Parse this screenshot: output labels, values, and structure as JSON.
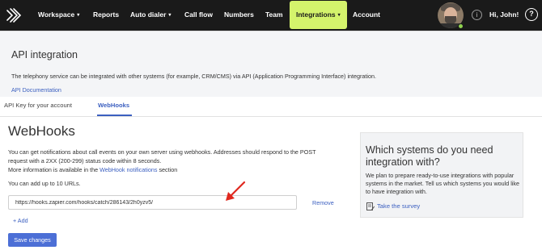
{
  "nav": {
    "items": [
      {
        "label": "Workspace",
        "dropdown": true
      },
      {
        "label": "Reports",
        "dropdown": false
      },
      {
        "label": "Auto dialer",
        "dropdown": true
      },
      {
        "label": "Call flow",
        "dropdown": false
      },
      {
        "label": "Numbers",
        "dropdown": false
      },
      {
        "label": "Team",
        "dropdown": false
      },
      {
        "label": "Integrations",
        "dropdown": true,
        "active": true
      },
      {
        "label": "Account",
        "dropdown": false
      }
    ],
    "greeting": "Hi, John!",
    "info_glyph": "i",
    "help_glyph": "?",
    "caret_glyph": "▾",
    "accent_color": "#d4f36c",
    "bar_color": "#1a1a1a"
  },
  "header": {
    "title": "API integration",
    "description": "The telephony service can be integrated with other systems (for example, CRM/CMS) via API (Application Programming Interface) integration.",
    "doc_link": "API Documentation"
  },
  "tabs": [
    {
      "label": "API Key for your account",
      "active": false
    },
    {
      "label": "WebHooks",
      "active": true
    }
  ],
  "webhooks": {
    "title": "WebHooks",
    "desc_line1": "You can get notifications about call events on your own server using webhooks. Addresses should respond to the POST",
    "desc_line2": "request with a 2XX (200-299) status code within 8 seconds.",
    "more_info_prefix": "More information is available in the ",
    "more_info_link": "WebHook notifications",
    "more_info_suffix": " section",
    "limit_text": "You can add up to 10 URLs.",
    "url_value": "https://hooks.zapier.com/hooks/catch/286143/2h0yzv5/",
    "remove_label": "Remove",
    "add_label": "+ Add",
    "save_label": "Save changes"
  },
  "side_panel": {
    "title": "Which systems do you need integration with?",
    "text": "We plan to prepare ready-to-use integrations with popular systems in the market. Tell us which systems you would like to have integration with.",
    "survey_link": "Take the survey"
  },
  "colors": {
    "link": "#3b5fc0",
    "button": "#4c6fd6",
    "annotation_arrow": "#e0281f"
  }
}
